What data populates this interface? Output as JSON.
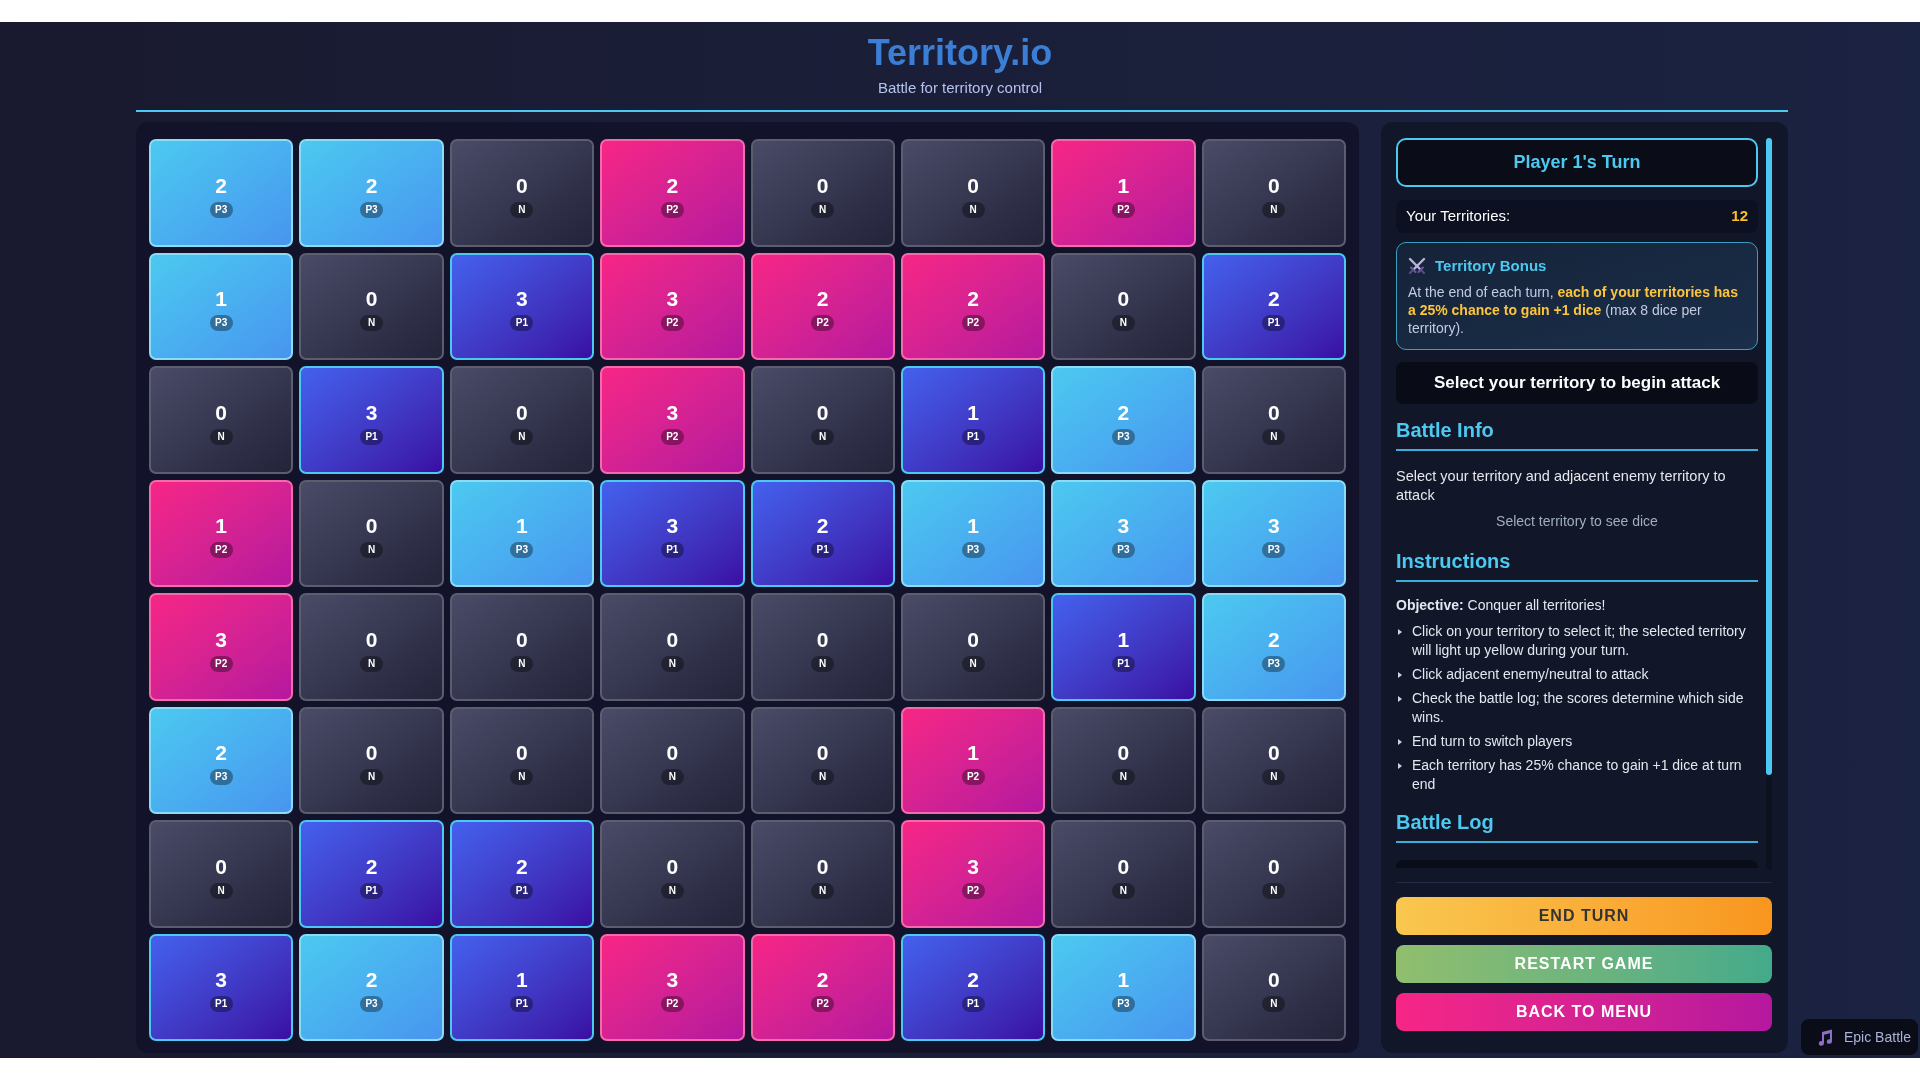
{
  "header": {
    "title": "Territory.io",
    "subtitle": "Battle for territory control"
  },
  "board": {
    "rows": [
      {
        "cells": [
          {
            "dice": "2",
            "owner": "P3",
            "kind": "player3"
          },
          {
            "dice": "2",
            "owner": "P3",
            "kind": "player3"
          },
          {
            "dice": "0",
            "owner": "N",
            "kind": "neutral"
          },
          {
            "dice": "2",
            "owner": "P2",
            "kind": "player2"
          },
          {
            "dice": "0",
            "owner": "N",
            "kind": "neutral"
          },
          {
            "dice": "0",
            "owner": "N",
            "kind": "neutral"
          },
          {
            "dice": "1",
            "owner": "P2",
            "kind": "player2"
          },
          {
            "dice": "0",
            "owner": "N",
            "kind": "neutral"
          }
        ]
      },
      {
        "cells": [
          {
            "dice": "1",
            "owner": "P3",
            "kind": "player3"
          },
          {
            "dice": "0",
            "owner": "N",
            "kind": "neutral"
          },
          {
            "dice": "3",
            "owner": "P1",
            "kind": "player1"
          },
          {
            "dice": "3",
            "owner": "P2",
            "kind": "player2"
          },
          {
            "dice": "2",
            "owner": "P2",
            "kind": "player2"
          },
          {
            "dice": "2",
            "owner": "P2",
            "kind": "player2"
          },
          {
            "dice": "0",
            "owner": "N",
            "kind": "neutral"
          },
          {
            "dice": "2",
            "owner": "P1",
            "kind": "player1"
          }
        ]
      },
      {
        "cells": [
          {
            "dice": "0",
            "owner": "N",
            "kind": "neutral"
          },
          {
            "dice": "3",
            "owner": "P1",
            "kind": "player1"
          },
          {
            "dice": "0",
            "owner": "N",
            "kind": "neutral"
          },
          {
            "dice": "3",
            "owner": "P2",
            "kind": "player2"
          },
          {
            "dice": "0",
            "owner": "N",
            "kind": "neutral"
          },
          {
            "dice": "1",
            "owner": "P1",
            "kind": "player1"
          },
          {
            "dice": "2",
            "owner": "P3",
            "kind": "player3"
          },
          {
            "dice": "0",
            "owner": "N",
            "kind": "neutral"
          }
        ]
      },
      {
        "cells": [
          {
            "dice": "1",
            "owner": "P2",
            "kind": "player2"
          },
          {
            "dice": "0",
            "owner": "N",
            "kind": "neutral"
          },
          {
            "dice": "1",
            "owner": "P3",
            "kind": "player3"
          },
          {
            "dice": "3",
            "owner": "P1",
            "kind": "player1"
          },
          {
            "dice": "2",
            "owner": "P1",
            "kind": "player1"
          },
          {
            "dice": "1",
            "owner": "P3",
            "kind": "player3"
          },
          {
            "dice": "3",
            "owner": "P3",
            "kind": "player3"
          },
          {
            "dice": "3",
            "owner": "P3",
            "kind": "player3"
          }
        ]
      },
      {
        "cells": [
          {
            "dice": "3",
            "owner": "P2",
            "kind": "player2"
          },
          {
            "dice": "0",
            "owner": "N",
            "kind": "neutral"
          },
          {
            "dice": "0",
            "owner": "N",
            "kind": "neutral"
          },
          {
            "dice": "0",
            "owner": "N",
            "kind": "neutral"
          },
          {
            "dice": "0",
            "owner": "N",
            "kind": "neutral"
          },
          {
            "dice": "0",
            "owner": "N",
            "kind": "neutral"
          },
          {
            "dice": "1",
            "owner": "P1",
            "kind": "player1"
          },
          {
            "dice": "2",
            "owner": "P3",
            "kind": "player3"
          }
        ]
      },
      {
        "cells": [
          {
            "dice": "2",
            "owner": "P3",
            "kind": "player3"
          },
          {
            "dice": "0",
            "owner": "N",
            "kind": "neutral"
          },
          {
            "dice": "0",
            "owner": "N",
            "kind": "neutral"
          },
          {
            "dice": "0",
            "owner": "N",
            "kind": "neutral"
          },
          {
            "dice": "0",
            "owner": "N",
            "kind": "neutral"
          },
          {
            "dice": "1",
            "owner": "P2",
            "kind": "player2"
          },
          {
            "dice": "0",
            "owner": "N",
            "kind": "neutral"
          },
          {
            "dice": "0",
            "owner": "N",
            "kind": "neutral"
          }
        ]
      },
      {
        "cells": [
          {
            "dice": "0",
            "owner": "N",
            "kind": "neutral"
          },
          {
            "dice": "2",
            "owner": "P1",
            "kind": "player1"
          },
          {
            "dice": "2",
            "owner": "P1",
            "kind": "player1"
          },
          {
            "dice": "0",
            "owner": "N",
            "kind": "neutral"
          },
          {
            "dice": "0",
            "owner": "N",
            "kind": "neutral"
          },
          {
            "dice": "3",
            "owner": "P2",
            "kind": "player2"
          },
          {
            "dice": "0",
            "owner": "N",
            "kind": "neutral"
          },
          {
            "dice": "0",
            "owner": "N",
            "kind": "neutral"
          }
        ]
      },
      {
        "cells": [
          {
            "dice": "3",
            "owner": "P1",
            "kind": "player1"
          },
          {
            "dice": "2",
            "owner": "P3",
            "kind": "player3"
          },
          {
            "dice": "1",
            "owner": "P1",
            "kind": "player1"
          },
          {
            "dice": "3",
            "owner": "P2",
            "kind": "player2"
          },
          {
            "dice": "2",
            "owner": "P2",
            "kind": "player2"
          },
          {
            "dice": "2",
            "owner": "P1",
            "kind": "player1"
          },
          {
            "dice": "1",
            "owner": "P3",
            "kind": "player3"
          },
          {
            "dice": "0",
            "owner": "N",
            "kind": "neutral"
          }
        ]
      }
    ]
  },
  "sidebar": {
    "turn_banner": "Player 1's Turn",
    "territories": {
      "label": "Your Territories:",
      "value": "12"
    },
    "bonus": {
      "title": "Territory Bonus",
      "text": "At the end of each turn, **each of your territories has a 25% chance to gain +1 dice** (max 8 dice per territory)."
    },
    "prompt": "Select your territory to begin attack",
    "battle_info": {
      "heading": "Battle Info",
      "text": "Select your territory and adjacent enemy territory to attack",
      "dice_hint": "Select territory to see dice"
    },
    "instructions": {
      "heading": "Instructions",
      "objective": "**Objective:** Conquer all territories!",
      "items": [
        "Click on your territory to select it; the selected territory will light up yellow during your turn.",
        "Click adjacent enemy/neutral to attack",
        "Check the battle log; the scores determine which side wins.",
        "End turn to switch players",
        "Each territory has 25% chance to gain +1 dice at turn end"
      ]
    },
    "battle_log": {
      "heading": "Battle Log"
    },
    "buttons": [
      {
        "label": "END TURN",
        "kind": "primary"
      },
      {
        "label": "RESTART GAME",
        "kind": "secondary"
      },
      {
        "label": "BACK TO MENU",
        "kind": "danger"
      }
    ]
  },
  "music": {
    "track": "Epic Battle"
  }
}
